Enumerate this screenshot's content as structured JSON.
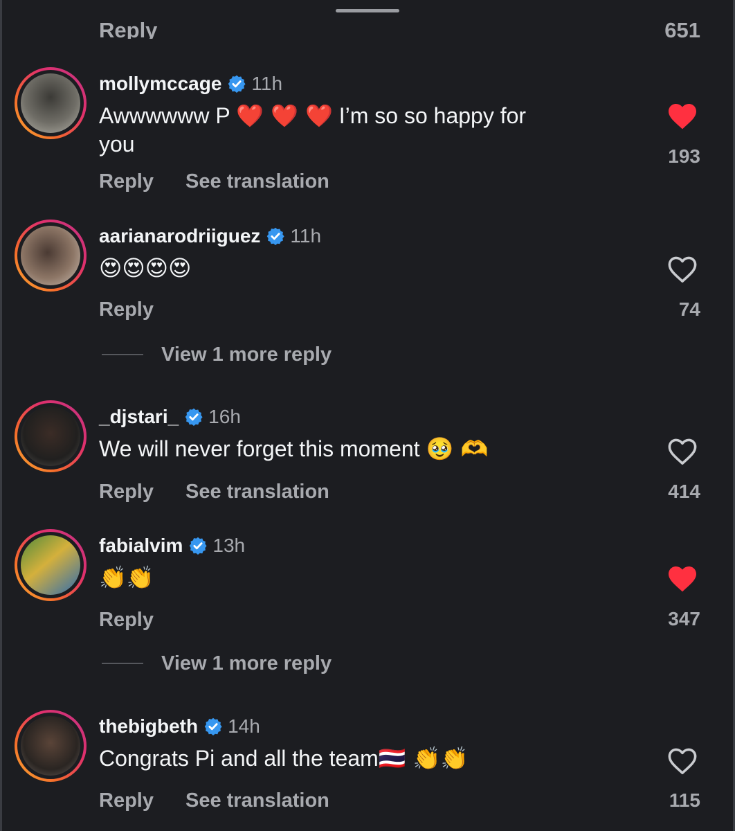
{
  "top_partial": {
    "reply_label": "Reply",
    "like_count": "651"
  },
  "comments": [
    {
      "username": "mollymccage",
      "time": "11h",
      "text_line1_a": "Awwwwww P ",
      "text_line1_emoji": "❤️ ❤️ ❤️",
      "text_line1_b": " I’m so so happy for",
      "text_line2": "you",
      "liked": true,
      "likes": "193",
      "reply_label": "Reply",
      "translate_label": "See translation"
    },
    {
      "username": "aarianarodriiguez",
      "time": "11h",
      "text_emoji": "😍😍😍😍",
      "liked": false,
      "likes": "74",
      "reply_label": "Reply",
      "view_more_label": "View 1 more reply"
    },
    {
      "username": "_djstari_",
      "time": "16h",
      "text": "We will never forget this moment ",
      "text_emoji": "🥹 🫶",
      "liked": false,
      "likes": "414",
      "reply_label": "Reply",
      "translate_label": "See translation"
    },
    {
      "username": "fabialvim",
      "time": "13h",
      "text_emoji": "👏👏",
      "liked": true,
      "likes": "347",
      "reply_label": "Reply",
      "view_more_label": "View 1 more reply"
    },
    {
      "username": "thebigbeth",
      "time": "14h",
      "text": "Congrats Pi and all the team",
      "text_emoji": "🇹🇭 👏👏",
      "liked": false,
      "likes": "115",
      "reply_label": "Reply",
      "translate_label": "See translation"
    }
  ],
  "colors": {
    "background": "#1c1d21",
    "primary_text": "#f3f5f7",
    "secondary_text": "#a8aaaf",
    "verified_blue": "#3797f0",
    "liked_red": "#ff3040"
  }
}
